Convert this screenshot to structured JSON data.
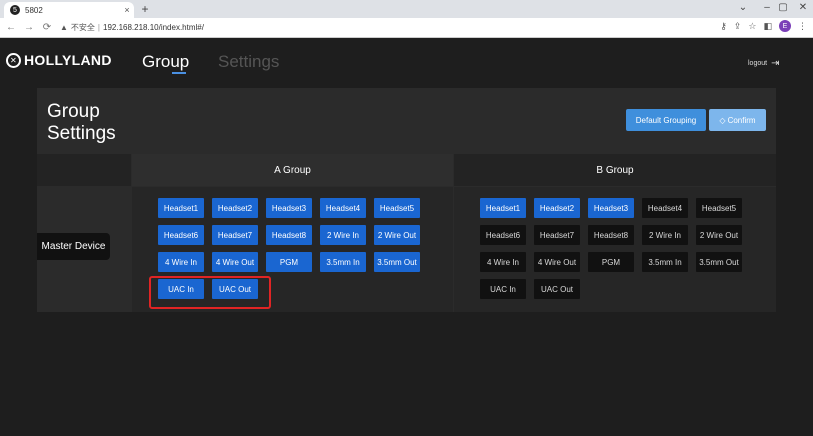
{
  "browser": {
    "tab_title": "5802",
    "favicon": "5",
    "tab_close": "×",
    "new_tab": "+",
    "insecure_label": "不安全",
    "url": "192.168.218.10/index.html#/",
    "window_controls": [
      "⌄",
      "–",
      "▢",
      "✕"
    ]
  },
  "app": {
    "brand": "HOLLYLAND",
    "nav": {
      "group": "Group",
      "settings": "Settings"
    },
    "logout": "logout"
  },
  "panel": {
    "title_line1": "Group",
    "title_line2": "Settings",
    "default_grouping": "Default Grouping",
    "confirm": "Confirm",
    "group_a": "A Group",
    "group_b": "B Group",
    "row_label": "Master Device"
  },
  "a_chips": [
    {
      "label": "Headset1",
      "active": true
    },
    {
      "label": "Headset2",
      "active": true
    },
    {
      "label": "Headset3",
      "active": true
    },
    {
      "label": "Headset4",
      "active": true
    },
    {
      "label": "Headset5",
      "active": true
    },
    {
      "label": "Headset6",
      "active": true
    },
    {
      "label": "Headset7",
      "active": true
    },
    {
      "label": "Headset8",
      "active": true
    },
    {
      "label": "2 Wire In",
      "active": true
    },
    {
      "label": "2 Wire Out",
      "active": true
    },
    {
      "label": "4 Wire In",
      "active": true
    },
    {
      "label": "4 Wire Out",
      "active": true
    },
    {
      "label": "PGM",
      "active": true
    },
    {
      "label": "3.5mm In",
      "active": true
    },
    {
      "label": "3.5mm Out",
      "active": true
    },
    {
      "label": "UAC In",
      "active": true
    },
    {
      "label": "UAC Out",
      "active": true
    }
  ],
  "b_chips": [
    {
      "label": "Headset1",
      "active": true
    },
    {
      "label": "Headset2",
      "active": true
    },
    {
      "label": "Headset3",
      "active": true
    },
    {
      "label": "Headset4",
      "active": false
    },
    {
      "label": "Headset5",
      "active": false
    },
    {
      "label": "Headset6",
      "active": false
    },
    {
      "label": "Headset7",
      "active": false
    },
    {
      "label": "Headset8",
      "active": false
    },
    {
      "label": "2 Wire In",
      "active": false
    },
    {
      "label": "2 Wire Out",
      "active": false
    },
    {
      "label": "4 Wire In",
      "active": false
    },
    {
      "label": "4 Wire Out",
      "active": false
    },
    {
      "label": "PGM",
      "active": false
    },
    {
      "label": "3.5mm In",
      "active": false
    },
    {
      "label": "3.5mm Out",
      "active": false
    },
    {
      "label": "UAC In",
      "active": false
    },
    {
      "label": "UAC Out",
      "active": false
    }
  ],
  "colors": {
    "chip_active": "#1a66d1",
    "chip_inactive": "#111111",
    "accent": "#4a90e2",
    "highlight": "#e02424"
  }
}
